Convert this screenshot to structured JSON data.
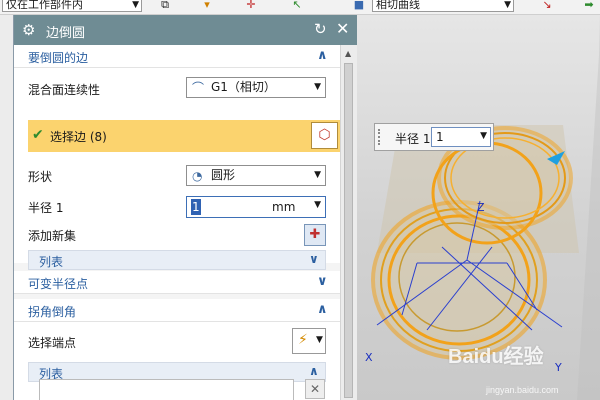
{
  "toolbar": {
    "scope_select": "仅在工作部件内",
    "curve_rule": "相切曲线"
  },
  "dialog": {
    "title": "边倒圆",
    "section_edges": {
      "title": "要倒圆的边",
      "continuity_label": "混合面连续性",
      "continuity_value": "G1（相切）",
      "select_edge": "选择边 (8)",
      "shape_label": "形状",
      "shape_value": "圆形",
      "radius_label": "半径 1",
      "radius_value": "1",
      "radius_unit": "mm",
      "add_new_set": "添加新集",
      "list_label": "列表"
    },
    "section_variable": {
      "title": "可变半径点"
    },
    "section_corner": {
      "title": "拐角倒角",
      "select_endpoint": "选择端点",
      "list_label": "列表"
    }
  },
  "viewport": {
    "radius_popup_label": "半径 1",
    "radius_popup_value": "1",
    "axis_labels": {
      "x": "X",
      "y": "Y",
      "z": "Z"
    }
  },
  "watermark": {
    "text": "Baidu经验",
    "url": "jingyan.baidu.com"
  },
  "colors": {
    "title_bar": "#6f8c94",
    "section_title": "#2b5fa0",
    "selected_row": "#fbd36e",
    "edge_highlight": "#f2a21a"
  }
}
